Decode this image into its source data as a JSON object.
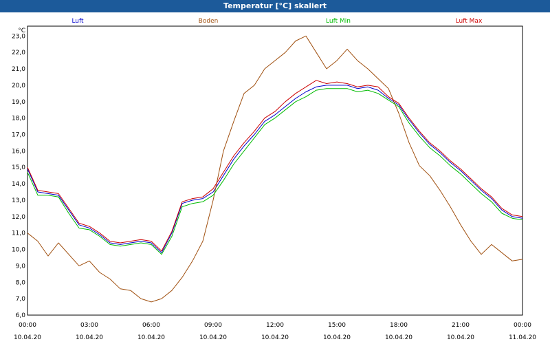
{
  "title": "Temperatur [°C] skaliert",
  "chart_data": {
    "type": "line",
    "title": "Temperatur [°C] skaliert",
    "ylabel": "°C",
    "xlabel": "",
    "ylim": [
      6.0,
      23.6
    ],
    "xlim": [
      0,
      24
    ],
    "grid": true,
    "legend_position": "top",
    "y_ticks": [
      "6,0",
      "7,0",
      "8,0",
      "9,0",
      "10,0",
      "11,0",
      "12,0",
      "13,0",
      "14,0",
      "15,0",
      "16,0",
      "17,0",
      "18,0",
      "19,0",
      "20,0",
      "21,0",
      "22,0",
      "23,0"
    ],
    "x_ticks": [
      {
        "time": "00:00",
        "date": "10.04.20"
      },
      {
        "time": "03:00",
        "date": "10.04.20"
      },
      {
        "time": "06:00",
        "date": "10.04.20"
      },
      {
        "time": "09:00",
        "date": "10.04.20"
      },
      {
        "time": "12:00",
        "date": "10.04.20"
      },
      {
        "time": "15:00",
        "date": "10.04.20"
      },
      {
        "time": "18:00",
        "date": "10.04.20"
      },
      {
        "time": "21:00",
        "date": "10.04.20"
      },
      {
        "time": "00:00",
        "date": "11.04.20"
      }
    ],
    "x": [
      0,
      0.5,
      1,
      1.5,
      2,
      2.5,
      3,
      3.5,
      4,
      4.5,
      5,
      5.5,
      6,
      6.5,
      7,
      7.5,
      8,
      8.5,
      9,
      9.5,
      10,
      10.5,
      11,
      11.5,
      12,
      12.5,
      13,
      13.5,
      14,
      14.5,
      15,
      15.5,
      16,
      16.5,
      17,
      17.5,
      18,
      18.5,
      19,
      19.5,
      20,
      20.5,
      21,
      21.5,
      22,
      22.5,
      23,
      23.5,
      24
    ],
    "series": [
      {
        "name": "Luft",
        "color": "#0000cc",
        "values": [
          14.9,
          13.5,
          13.4,
          13.3,
          12.4,
          11.5,
          11.3,
          10.9,
          10.4,
          10.3,
          10.4,
          10.5,
          10.4,
          9.8,
          11.0,
          12.8,
          13.0,
          13.1,
          13.5,
          14.5,
          15.5,
          16.3,
          17.0,
          17.8,
          18.2,
          18.7,
          19.2,
          19.6,
          19.9,
          20.0,
          20.0,
          20.0,
          19.8,
          19.9,
          19.7,
          19.2,
          18.8,
          17.9,
          17.1,
          16.4,
          15.9,
          15.3,
          14.8,
          14.2,
          13.6,
          13.1,
          12.4,
          12.0,
          11.9
        ]
      },
      {
        "name": "Boden",
        "color": "#a05010",
        "values": [
          11.0,
          10.5,
          9.6,
          10.4,
          9.7,
          9.0,
          9.3,
          8.6,
          8.2,
          7.6,
          7.5,
          7.0,
          6.8,
          7.0,
          7.5,
          8.3,
          9.3,
          10.5,
          13.0,
          16.0,
          17.8,
          19.5,
          20.0,
          21.0,
          21.5,
          22.0,
          22.7,
          23.0,
          22.0,
          21.0,
          21.5,
          22.2,
          21.5,
          21.0,
          20.4,
          19.8,
          18.3,
          16.5,
          15.1,
          14.5,
          13.6,
          12.6,
          11.5,
          10.5,
          9.7,
          10.3,
          9.8,
          9.3,
          9.4
        ]
      },
      {
        "name": "Luft Min",
        "color": "#00bb00",
        "values": [
          14.7,
          13.3,
          13.3,
          13.2,
          12.2,
          11.3,
          11.2,
          10.8,
          10.3,
          10.2,
          10.3,
          10.4,
          10.3,
          9.7,
          10.8,
          12.6,
          12.8,
          12.9,
          13.3,
          14.2,
          15.2,
          16.0,
          16.8,
          17.6,
          18.0,
          18.5,
          19.0,
          19.3,
          19.7,
          19.8,
          19.8,
          19.8,
          19.6,
          19.7,
          19.5,
          19.1,
          18.7,
          17.7,
          16.9,
          16.2,
          15.7,
          15.1,
          14.6,
          14.0,
          13.4,
          12.9,
          12.2,
          11.9,
          11.8
        ]
      },
      {
        "name": "Luft Max",
        "color": "#cc0000",
        "values": [
          15.0,
          13.6,
          13.5,
          13.4,
          12.5,
          11.6,
          11.4,
          11.0,
          10.5,
          10.4,
          10.5,
          10.6,
          10.5,
          9.9,
          11.1,
          12.9,
          13.1,
          13.2,
          13.7,
          14.7,
          15.7,
          16.5,
          17.2,
          18.0,
          18.4,
          19.0,
          19.5,
          19.9,
          20.3,
          20.1,
          20.2,
          20.1,
          19.9,
          20.0,
          19.9,
          19.3,
          18.9,
          18.0,
          17.2,
          16.5,
          16.0,
          15.4,
          14.9,
          14.3,
          13.7,
          13.2,
          12.5,
          12.1,
          12.0
        ]
      }
    ]
  }
}
